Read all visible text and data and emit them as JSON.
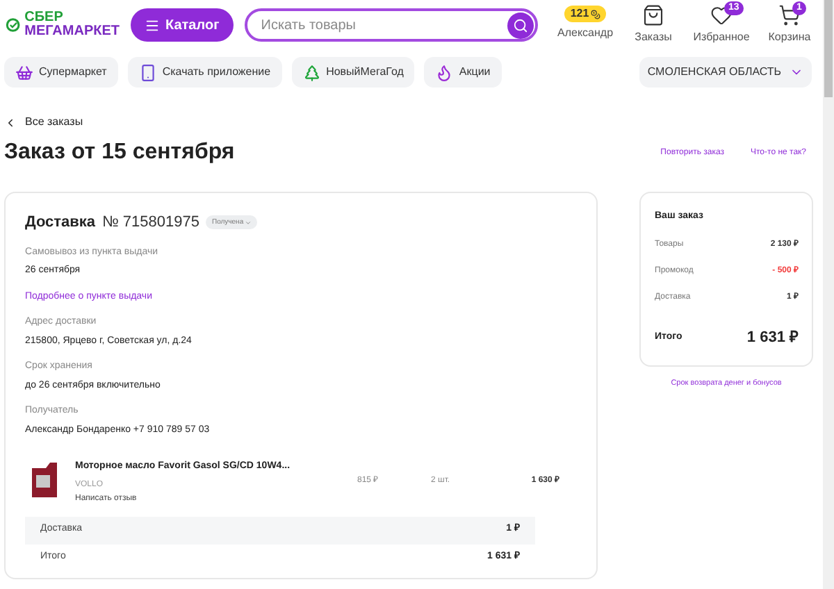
{
  "header": {
    "logo": [
      "СБЕР",
      "МЕГАМАРКЕТ"
    ],
    "catalog_button": "Каталог",
    "search": {
      "placeholder": "Искать товары"
    },
    "nav": [
      {
        "kind": "profile",
        "label": "Александр",
        "badge": "121"
      },
      {
        "kind": "orders",
        "label": "Заказы"
      },
      {
        "kind": "favorites",
        "label": "Избранное",
        "badge": "13"
      },
      {
        "kind": "cart",
        "label": "Корзина",
        "badge": "1"
      }
    ]
  },
  "chips": [
    {
      "kind": "basket",
      "label": "Супермаркет"
    },
    {
      "kind": "app",
      "label": "Скачать приложение"
    },
    {
      "kind": "tree",
      "label": "НовыйМегаГод"
    },
    {
      "kind": "fire",
      "label": "Акции"
    }
  ],
  "region": "СМОЛЕНСКАЯ ОБЛАСТЬ",
  "back_link": "Все заказы",
  "title": "Заказ от 15 сентября",
  "actions": [
    "Повторить заказ",
    "Что-то не так?"
  ],
  "delivery": {
    "heading": "Доставка",
    "number": "№ 715801975",
    "status": "Получена",
    "fields": [
      {
        "label": "Самовывоз из пункта выдачи",
        "value": "26 сентября",
        "link": "Подробнее о пункте выдачи"
      },
      {
        "label": "Адрес доставки",
        "value": "215800, Ярцево г, Советская ул, д.24"
      },
      {
        "label": "Срок хранения",
        "value": "до 26 сентября включительно"
      },
      {
        "label": "Получатель",
        "value": "Александр Бондаренко +7 910 789 57 03"
      }
    ],
    "item": {
      "name": "Моторное масло Favorit Gasol SG/CD 10W4...",
      "brand": "VOLLO",
      "review": "Написать отзыв",
      "price": "815 ₽",
      "qty": "2 шт.",
      "total": "1 630 ₽"
    },
    "shipping_row": {
      "label": "Доставка",
      "value": "1 ₽"
    },
    "total_row": {
      "label": "Итого",
      "value": "1 631 ₽"
    }
  },
  "summary": {
    "title": "Ваш заказ",
    "rows": [
      {
        "kind": "normal",
        "label": "Товары",
        "value": "2 130 ₽"
      },
      {
        "kind": "discount",
        "label": "Промокод",
        "value": "- 500 ₽"
      },
      {
        "kind": "normal",
        "label": "Доставка",
        "value": "1 ₽"
      }
    ],
    "total_label": "Итого",
    "total_value": "1 631 ₽",
    "link": "Срок возврата денег и бонусов"
  }
}
